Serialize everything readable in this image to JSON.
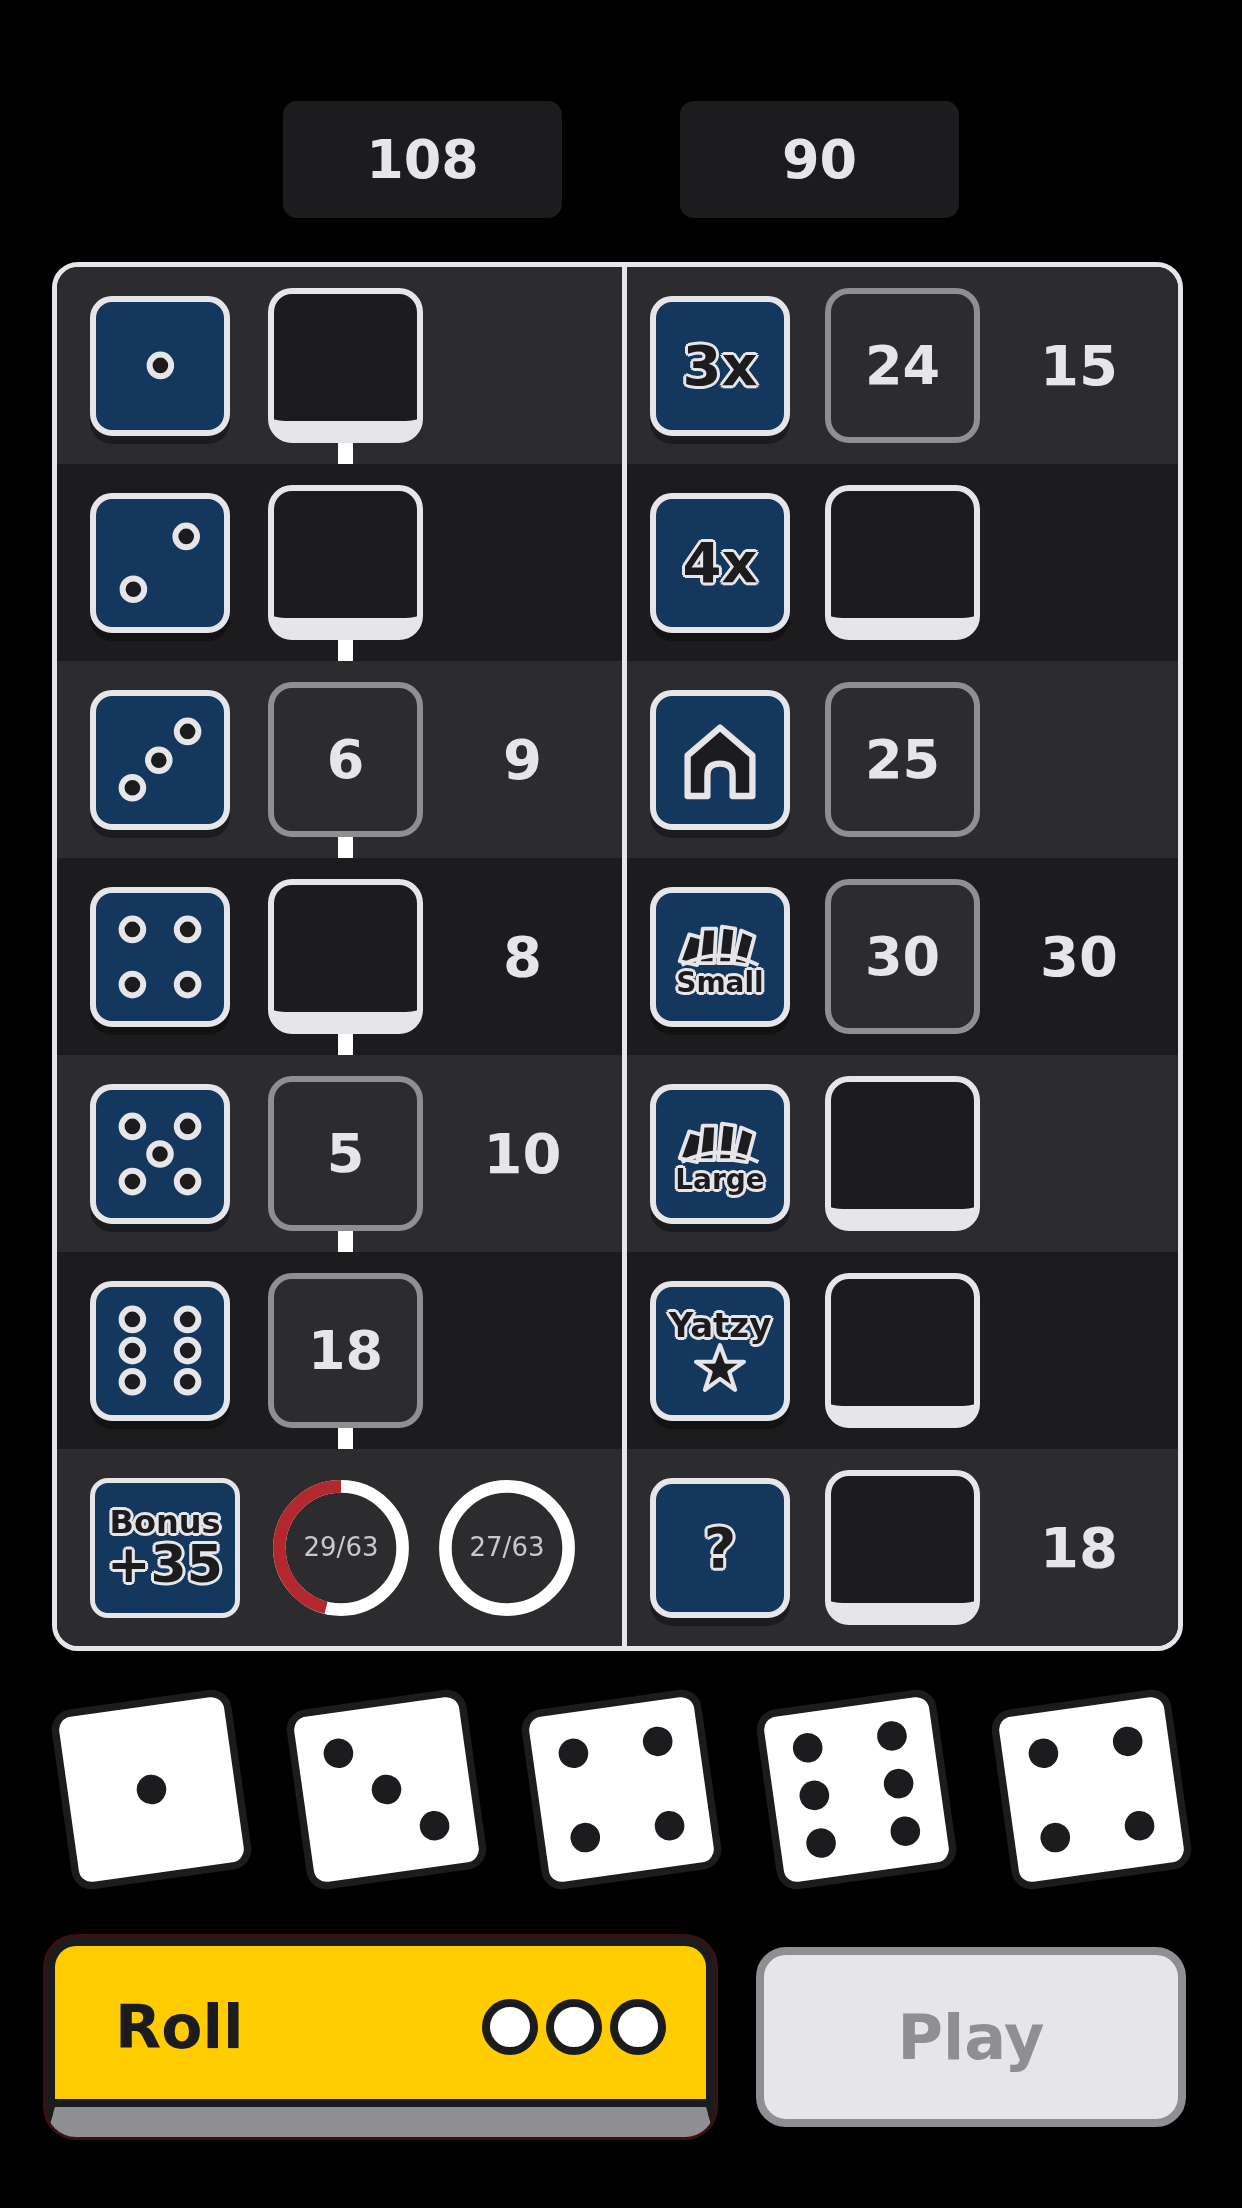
{
  "scores": [
    {
      "value": "108"
    },
    {
      "value": "90"
    }
  ],
  "upper": [
    {
      "icon": {
        "kind": "one"
      },
      "box": {
        "kind": "open"
      }
    },
    {
      "icon": {
        "kind": "two"
      },
      "box": {
        "kind": "open"
      }
    },
    {
      "icon": {
        "kind": "three"
      },
      "box": {
        "kind": "scored",
        "value": "6"
      },
      "column_3": "9"
    },
    {
      "icon": {
        "kind": "four"
      },
      "box": {
        "kind": "open"
      },
      "column_3": "8"
    },
    {
      "icon": {
        "kind": "five"
      },
      "box": {
        "kind": "scored",
        "value": "5"
      },
      "column_3": "10"
    },
    {
      "icon": {
        "kind": "six"
      },
      "box": {
        "kind": "scored",
        "value": "18"
      }
    }
  ],
  "bonus": {
    "icon": {
      "top": "Bonus",
      "bottom": "+35"
    },
    "rings": [
      {
        "text": "29/63",
        "level": 0.46
      },
      {
        "text": "27/63"
      }
    ]
  },
  "lower": [
    {
      "icon": {
        "kind": "text",
        "label": "3x"
      },
      "box": {
        "kind": "scored",
        "value": "24"
      },
      "column_3": "15"
    },
    {
      "icon": {
        "kind": "text",
        "label": "4x"
      },
      "box": {
        "kind": "open"
      }
    },
    {
      "icon": {
        "kind": "house"
      },
      "box": {
        "kind": "scored",
        "value": "25"
      }
    },
    {
      "icon": {
        "kind": "cards",
        "label": "Small"
      },
      "box": {
        "kind": "scored",
        "value": "30"
      },
      "column_3": "30"
    },
    {
      "icon": {
        "kind": "cards",
        "label": "Large"
      },
      "box": {
        "kind": "open"
      }
    },
    {
      "icon": {
        "kind": "star",
        "label": "Yatzy"
      },
      "box": {
        "kind": "open"
      }
    },
    {
      "icon": {
        "kind": "text",
        "label": "?"
      },
      "box": {
        "kind": "open"
      },
      "column_3": "18"
    }
  ],
  "dice": [
    {
      "kind": "one"
    },
    {
      "kind": "three"
    },
    {
      "kind": "four"
    },
    {
      "kind": "six"
    },
    {
      "kind": "four"
    }
  ],
  "roll_button": {
    "label": "Roll",
    "rolls": [
      {
        "available": true
      },
      {
        "available": true
      },
      {
        "available": true
      }
    ]
  },
  "play_button": {
    "label": "Play",
    "disabled": true
  }
}
